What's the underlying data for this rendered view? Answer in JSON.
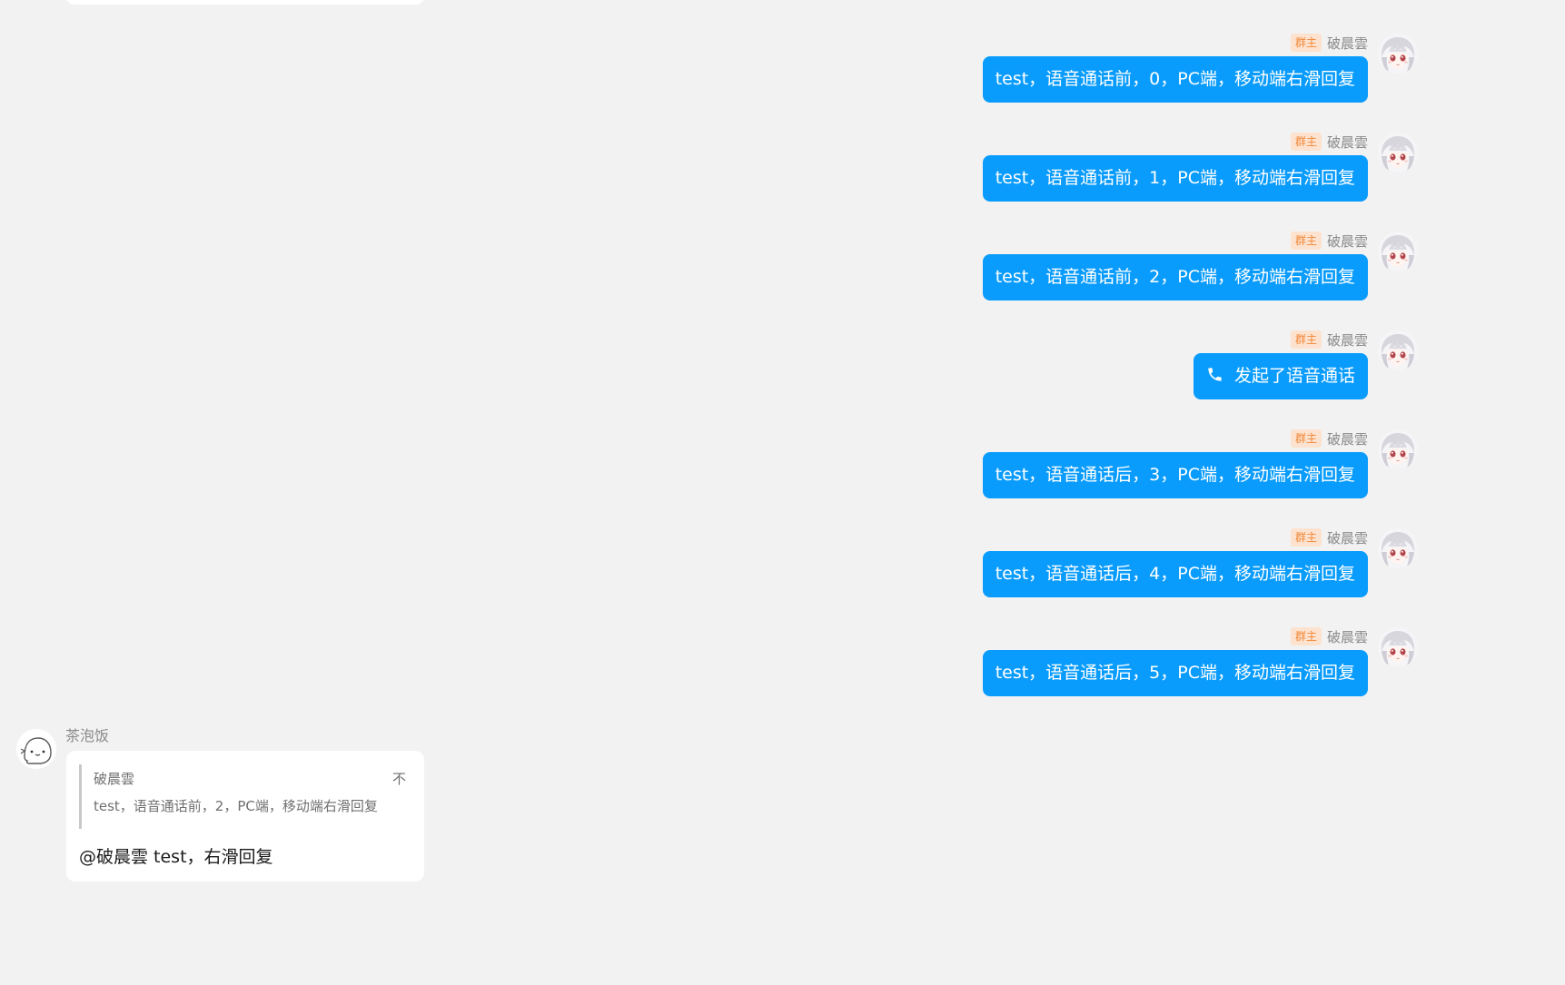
{
  "colors": {
    "page_background": "#f2f2f2",
    "self_bubble": "#0a9cfd",
    "role_badge_bg": "#fde3cf",
    "role_badge_text": "#f0883a"
  },
  "messages": [
    {
      "sender": "破晨雲",
      "role_badge": "群主",
      "avatar_icon": "anime-girl-avatar-icon",
      "text": "test，语音通话前，0，PC端，移动端右滑回复"
    },
    {
      "sender": "破晨雲",
      "role_badge": "群主",
      "avatar_icon": "anime-girl-avatar-icon",
      "text": "test，语音通话前，1，PC端，移动端右滑回复"
    },
    {
      "sender": "破晨雲",
      "role_badge": "群主",
      "avatar_icon": "anime-girl-avatar-icon",
      "text": "test，语音通话前，2，PC端，移动端右滑回复"
    },
    {
      "sender": "破晨雲",
      "role_badge": "群主",
      "avatar_icon": "anime-girl-avatar-icon",
      "text": "发起了语音通话",
      "icon": "phone-icon"
    },
    {
      "sender": "破晨雲",
      "role_badge": "群主",
      "avatar_icon": "anime-girl-avatar-icon",
      "text": "test，语音通话后，3，PC端，移动端右滑回复"
    },
    {
      "sender": "破晨雲",
      "role_badge": "群主",
      "avatar_icon": "anime-girl-avatar-icon",
      "text": "test，语音通话后，4，PC端，移动端右滑回复"
    },
    {
      "sender": "破晨雲",
      "role_badge": "群主",
      "avatar_icon": "anime-girl-avatar-icon",
      "text": "test，语音通话后，5，PC端，移动端右滑回复"
    }
  ],
  "reply_message": {
    "sender": "茶泡饭",
    "avatar_icon": "ghost-avatar-icon",
    "quote": {
      "author": "破晨雲",
      "more": "不",
      "text": "test，语音通话前，2，PC端，移动端右滑回复"
    },
    "text": "@破晨雲 test，右滑回复"
  }
}
